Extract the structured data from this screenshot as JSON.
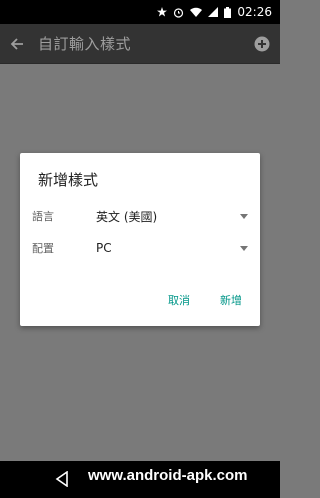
{
  "status_bar": {
    "time": "02:26"
  },
  "app_bar": {
    "title": "自訂輸入樣式"
  },
  "dialog": {
    "title": "新增樣式",
    "language": {
      "label": "語言",
      "value": "英文 (美國)"
    },
    "layout": {
      "label": "配置",
      "value": "PC"
    },
    "cancel_label": "取消",
    "add_label": "新增"
  },
  "watermark": "www.android-apk.com",
  "colors": {
    "accent": "#009688",
    "app_bar": "#333333",
    "scrim": "#7a7a7a"
  }
}
